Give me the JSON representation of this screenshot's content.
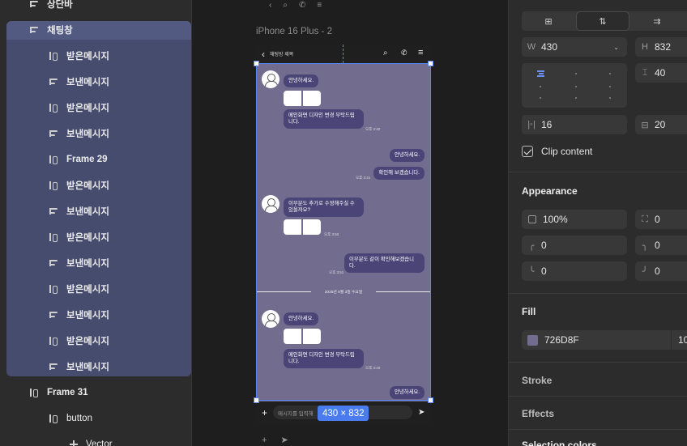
{
  "layers": {
    "items": [
      {
        "label": "상단바",
        "icon": "auto-layout-vertical-icon"
      },
      {
        "label": "채팅창",
        "icon": "auto-layout-vertical-icon"
      },
      {
        "label": "받은메시지",
        "icon": "auto-layout-horizontal-icon"
      },
      {
        "label": "보낸메시지",
        "icon": "auto-layout-vertical-icon"
      },
      {
        "label": "받은메시지",
        "icon": "auto-layout-horizontal-icon"
      },
      {
        "label": "보낸메시지",
        "icon": "auto-layout-vertical-icon"
      },
      {
        "label": "Frame 29",
        "icon": "auto-layout-horizontal-icon"
      },
      {
        "label": "받은메시지",
        "icon": "auto-layout-horizontal-icon"
      },
      {
        "label": "보낸메시지",
        "icon": "auto-layout-vertical-icon"
      },
      {
        "label": "받은메시지",
        "icon": "auto-layout-horizontal-icon"
      },
      {
        "label": "보낸메시지",
        "icon": "auto-layout-vertical-icon"
      },
      {
        "label": "받은메시지",
        "icon": "auto-layout-horizontal-icon"
      },
      {
        "label": "보낸메시지",
        "icon": "auto-layout-vertical-icon"
      },
      {
        "label": "받은메시지",
        "icon": "auto-layout-horizontal-icon"
      },
      {
        "label": "보낸메시지",
        "icon": "auto-layout-vertical-icon"
      },
      {
        "label": "Frame 31",
        "icon": "auto-layout-horizontal-icon"
      },
      {
        "label": "button",
        "icon": "auto-layout-horizontal-icon"
      },
      {
        "label": "Vector",
        "icon": "vector-plus-icon"
      }
    ]
  },
  "canvas": {
    "frame_label": "iPhone 16 Plus - 2",
    "header_title": "채팅방 제목",
    "composer_placeholder": "메시지를 입력해",
    "size_badge": "430 × 832",
    "messages": {
      "m1": "안녕하세요.",
      "m2": "메인화면 디자인 변경 부탁드립니다.",
      "m2_time": "오후 3:40",
      "m3": "안녕하세요.",
      "m4": "확인해 보겠습니다.",
      "m4_time": "오후 3:41",
      "m5": "이부분도 추가로 수정해주실 수 있을까요?",
      "m5_time": "오후 3:50",
      "m6": "이부분도 같이 확인해보겠습니다.",
      "m6_time": "오후 3:51",
      "date": "2025년 9월 3일 수요일",
      "m7": "안녕하세요.",
      "m8": "메인화면 디자인 변경 부탁드립니다.",
      "m8_time": "오후 3:40",
      "m9": "안녕하세요."
    },
    "colors": {
      "chat_bg": "#726D8F",
      "bubble": "#4B4577",
      "selection": "#5B83F2"
    }
  },
  "props": {
    "width_label": "W",
    "width": "430",
    "height_label": "H",
    "height": "832",
    "gap": "40",
    "padding_h": "16",
    "padding_v": "20",
    "clip_content": "Clip content",
    "appearance_title": "Appearance",
    "opacity": "100%",
    "corner_all": "0",
    "corner_tl": "0",
    "corner_tr": "0",
    "corner_bl": "0",
    "corner_br": "0",
    "fill_title": "Fill",
    "fill_hex": "726D8F",
    "fill_opacity": "10",
    "stroke_title": "Stroke",
    "effects_title": "Effects",
    "selection_colors_title": "Selection colors"
  }
}
